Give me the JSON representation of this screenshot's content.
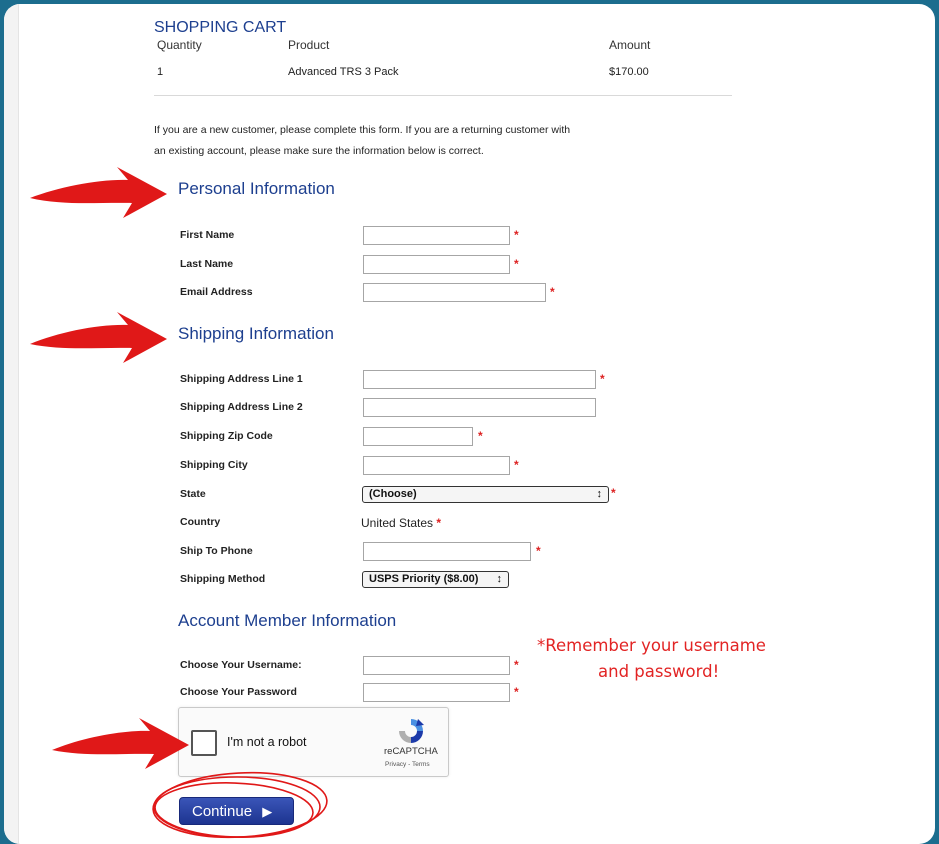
{
  "cart": {
    "title": "SHOPPING CART",
    "columns": {
      "quantity": "Quantity",
      "product": "Product",
      "amount": "Amount"
    },
    "rows": [
      {
        "quantity": "1",
        "product": "Advanced TRS 3 Pack",
        "amount": "$170.00"
      }
    ]
  },
  "intro": {
    "line1": "If you are a new customer, please complete this form.  If you are a returning customer with",
    "line2": "an existing account, please make sure the information below is correct."
  },
  "personal": {
    "title": "Personal Information",
    "first_name_label": "First Name",
    "last_name_label": "Last Name",
    "email_label": "Email Address"
  },
  "shipping": {
    "title": "Shipping Information",
    "address1_label": "Shipping Address Line 1",
    "address2_label": "Shipping Address Line 2",
    "zip_label": "Shipping Zip Code",
    "city_label": "Shipping City",
    "state_label": "State",
    "state_value": "(Choose)",
    "country_label": "Country",
    "country_value": "United States",
    "phone_label": "Ship To Phone",
    "method_label": "Shipping Method",
    "method_value": "USPS Priority ($8.00)"
  },
  "account": {
    "title": "Account Member Information",
    "username_label": "Choose Your Username:",
    "password_label": "Choose Your Password"
  },
  "required_marker": "*",
  "annotation": {
    "line1": "*Remember your username",
    "line2": "and password!"
  },
  "captcha": {
    "label": "I'm not a robot",
    "brand": "reCAPTCHA",
    "terms": "Privacy - Terms"
  },
  "continue_label": "Continue",
  "colors": {
    "heading_blue": "#1d3f8f",
    "required_red": "#dd2222",
    "annotation_red": "#e22424",
    "button_blue": "#2a44a6",
    "frame_teal": "#1c6d8e"
  },
  "icons": [
    "arrow-right-annotation-icon",
    "recaptcha-logo-icon",
    "triangle-right-icon",
    "select-updown-icon"
  ]
}
